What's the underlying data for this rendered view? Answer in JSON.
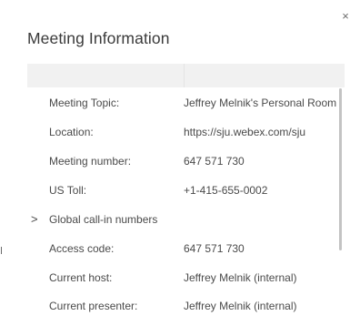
{
  "dialog": {
    "title": "Meeting Information",
    "close_glyph": "×"
  },
  "rows": [
    {
      "label": "Meeting Topic:",
      "value": "Jeffrey Melnik's Personal Room"
    },
    {
      "label": "Location:",
      "value": "https://sju.webex.com/sju"
    },
    {
      "label": "Meeting number:",
      "value": "647 571 730"
    },
    {
      "label": "US Toll:",
      "value": "+1-415-655-0002"
    },
    {
      "label": "Global call-in numbers",
      "value": "",
      "expandable": true,
      "chevron": ">"
    },
    {
      "label": "Access code:",
      "value": "647 571 730"
    },
    {
      "label": "Current host:",
      "value": "Jeffrey Melnik (internal)"
    },
    {
      "label": "Current presenter:",
      "value": "Jeffrey Melnik (internal)"
    }
  ]
}
